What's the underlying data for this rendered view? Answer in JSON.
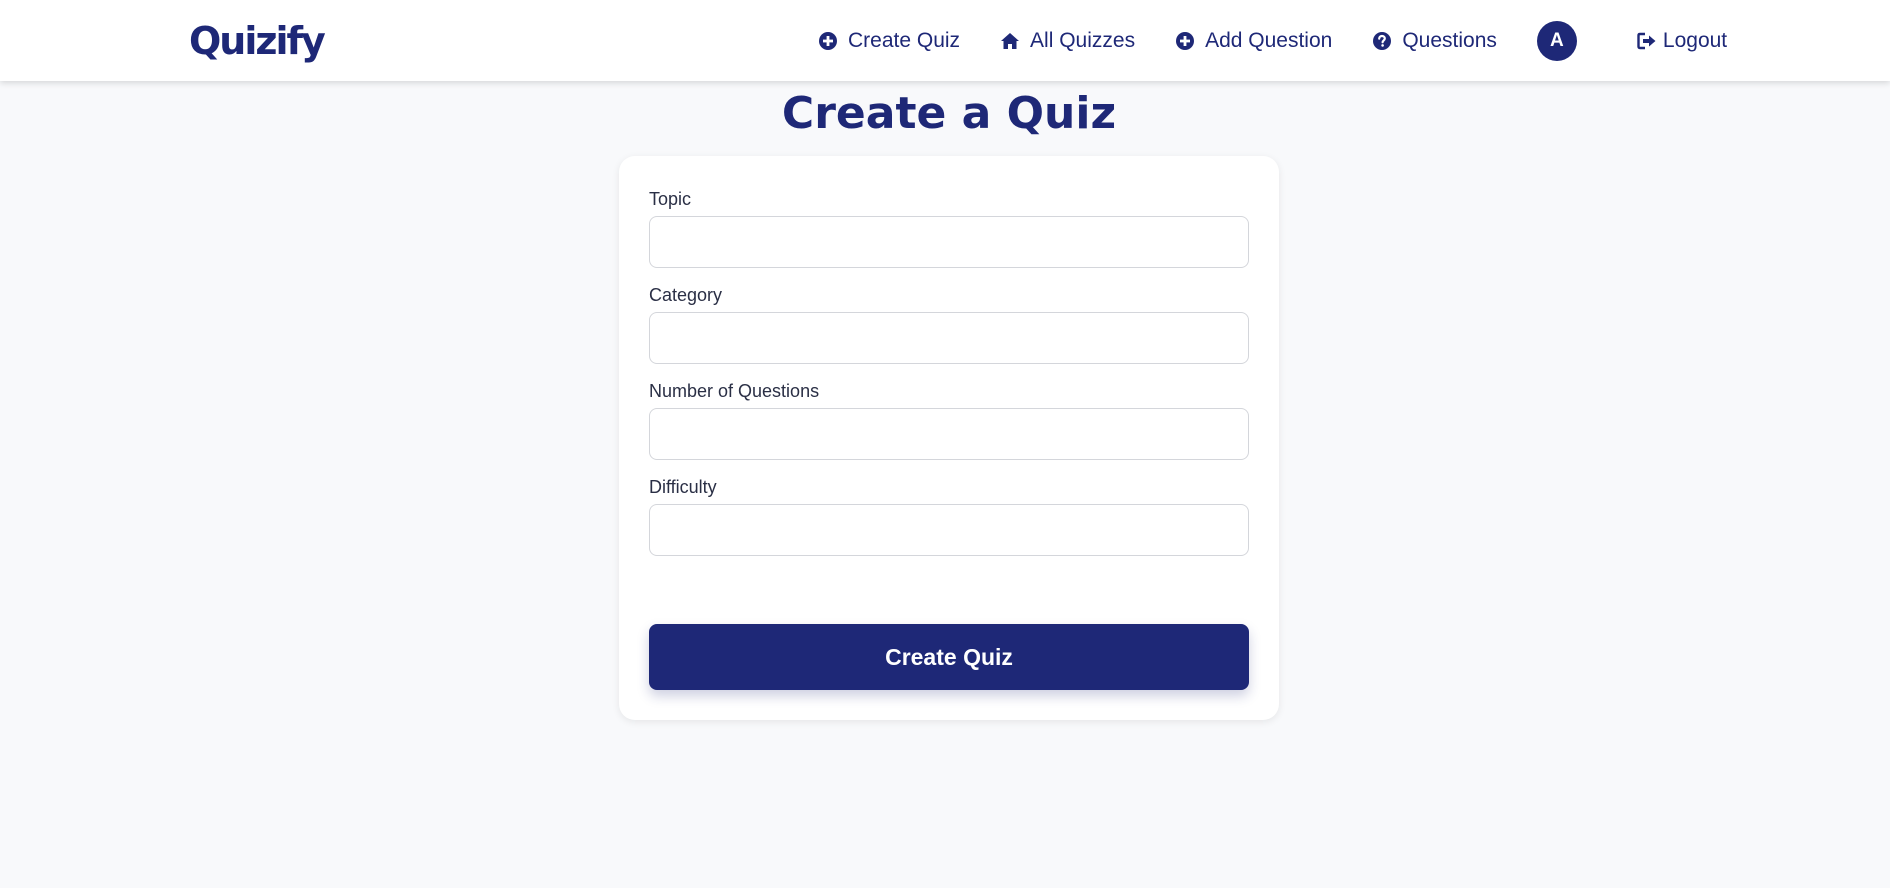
{
  "app": {
    "brand": "Quizify"
  },
  "nav": {
    "create_quiz": "Create Quiz",
    "all_quizzes": "All Quizzes",
    "add_question": "Add Question",
    "questions": "Questions",
    "avatar_initial": "A",
    "logout": "Logout"
  },
  "page": {
    "title": "Create a Quiz"
  },
  "form": {
    "topic": {
      "label": "Topic",
      "value": "",
      "placeholder": ""
    },
    "category": {
      "label": "Category",
      "value": "",
      "placeholder": ""
    },
    "num_questions": {
      "label": "Number of Questions",
      "value": "",
      "placeholder": ""
    },
    "difficulty": {
      "label": "Difficulty",
      "value": "",
      "placeholder": ""
    },
    "submit_label": "Create Quiz"
  },
  "icons": {
    "create_quiz": "plus-circle-icon",
    "all_quizzes": "home-icon",
    "add_question": "plus-circle-icon",
    "questions": "question-circle-icon",
    "logout": "logout-icon"
  },
  "colors": {
    "primary": "#1e2877",
    "background": "#f8f9fb",
    "card": "#ffffff"
  }
}
